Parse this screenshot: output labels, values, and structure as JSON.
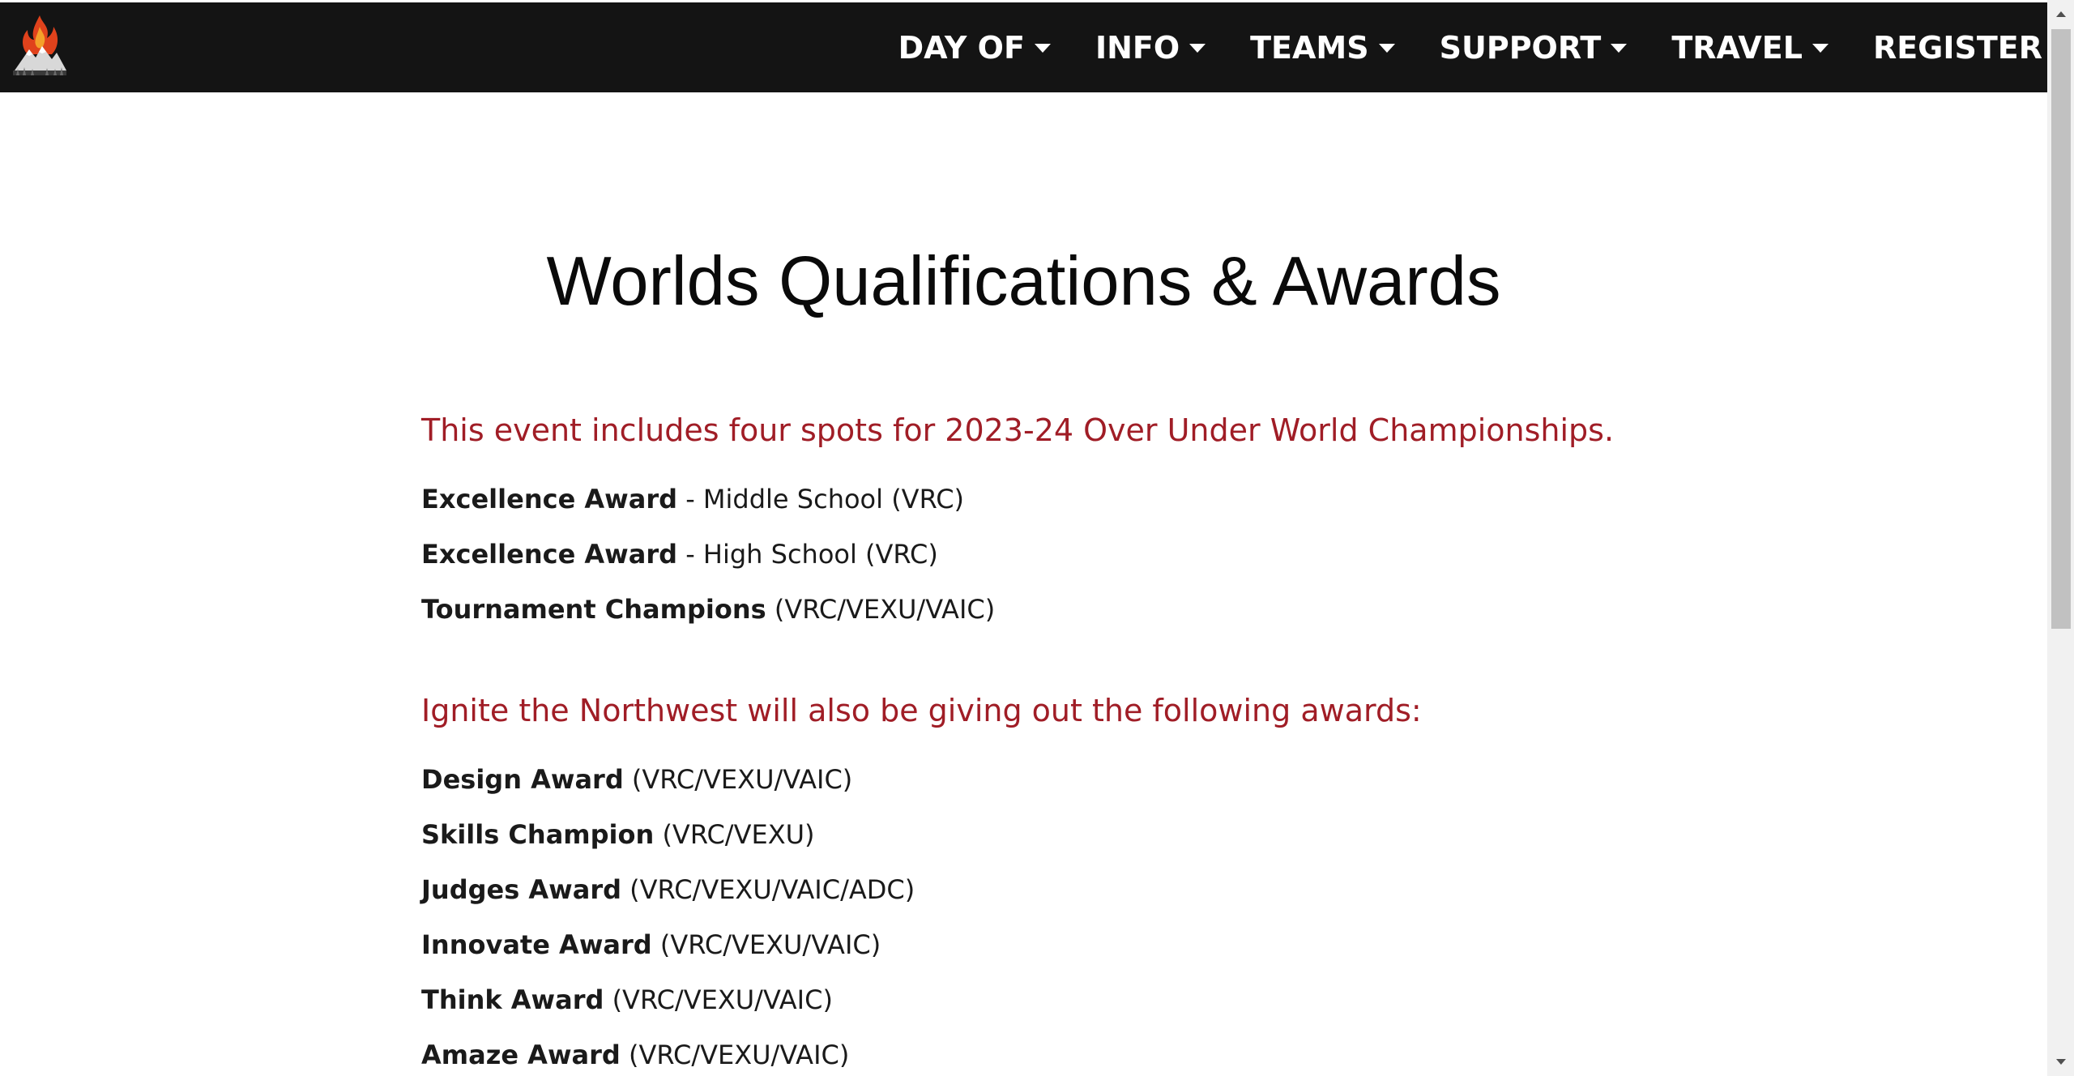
{
  "nav": {
    "logo_alt": "Ignite the Northwest logo",
    "items": [
      {
        "label": "DAY OF",
        "has_dropdown": true
      },
      {
        "label": "INFO",
        "has_dropdown": true
      },
      {
        "label": "TEAMS",
        "has_dropdown": true
      },
      {
        "label": "SUPPORT",
        "has_dropdown": true
      },
      {
        "label": "TRAVEL",
        "has_dropdown": true
      },
      {
        "label": "REGISTER",
        "has_dropdown": false
      }
    ]
  },
  "main": {
    "title": "Worlds Qualifications & Awards",
    "sections": [
      {
        "heading": "This event includes four spots for 2023-24 Over Under World Championships.",
        "awards": [
          {
            "name": "Excellence Award",
            "detail": " - Middle School (VRC)"
          },
          {
            "name": "Excellence Award",
            "detail": " - High School (VRC)"
          },
          {
            "name": "Tournament Champions",
            "detail": " (VRC/VEXU/VAIC)"
          }
        ]
      },
      {
        "heading": "Ignite the Northwest will also be giving out the following awards:",
        "awards": [
          {
            "name": "Design Award",
            "detail": " (VRC/VEXU/VAIC)"
          },
          {
            "name": "Skills Champion",
            "detail": " (VRC/VEXU)"
          },
          {
            "name": "Judges Award",
            "detail": " (VRC/VEXU/VAIC/ADC)"
          },
          {
            "name": "Innovate Award",
            "detail": " (VRC/VEXU/VAIC)"
          },
          {
            "name": "Think Award",
            "detail": " (VRC/VEXU/VAIC)"
          },
          {
            "name": "Amaze Award",
            "detail": " (VRC/VEXU/VAIC)"
          }
        ]
      }
    ]
  },
  "colors": {
    "navbar_bg": "#141414",
    "heading_red": "#a01d26",
    "text": "#1a1a1a"
  },
  "icons": {
    "logo": "flame-mountain-logo",
    "dropdown": "caret-down-icon",
    "scroll_up": "scroll-up-arrow-icon",
    "scroll_down": "scroll-down-arrow-icon"
  }
}
